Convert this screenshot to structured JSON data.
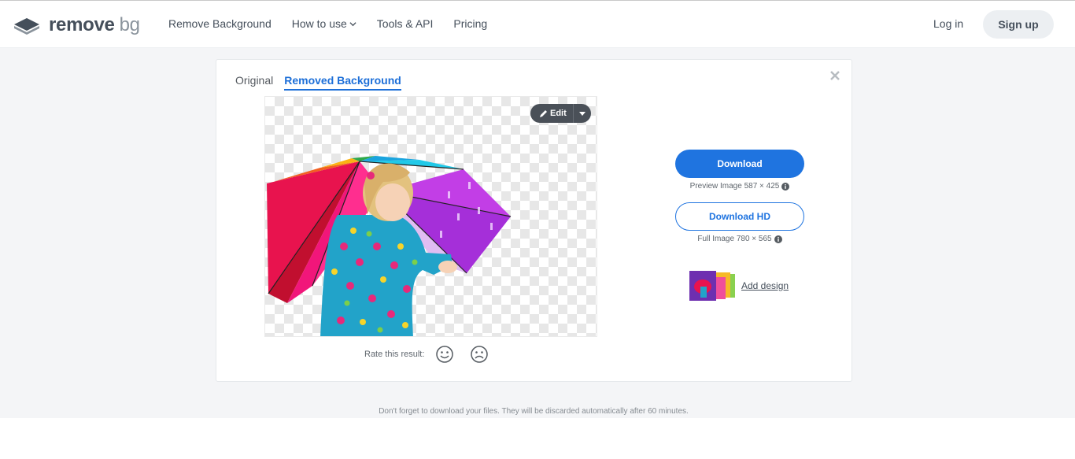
{
  "header": {
    "logo_word": "remove",
    "logo_suffix": "bg",
    "nav": {
      "remove_background": "Remove Background",
      "how_to_use": "How to use",
      "tools_api": "Tools & API",
      "pricing": "Pricing"
    },
    "login": "Log in",
    "signup": "Sign up"
  },
  "result": {
    "tabs": {
      "original": "Original",
      "removed": "Removed Background"
    },
    "edit_label": "Edit",
    "rate_label": "Rate this result:",
    "download_label": "Download",
    "download_sub": "Preview Image 587 × 425",
    "download_hd_label": "Download HD",
    "download_hd_sub": "Full Image 780 × 565",
    "add_design": "Add design"
  },
  "footer_note": "Don't forget to download your files. They will be discarded automatically after 60 minutes.",
  "colors": {
    "accent": "#1f74e0",
    "edit_button": "#4a5058",
    "page_bg": "#f4f5f7"
  },
  "icons": [
    "logo-icon",
    "chevron-down-icon",
    "close-icon",
    "pencil-icon",
    "caret-down-icon",
    "smile-icon",
    "frown-icon",
    "info-icon",
    "design-thumbnail-icon"
  ]
}
